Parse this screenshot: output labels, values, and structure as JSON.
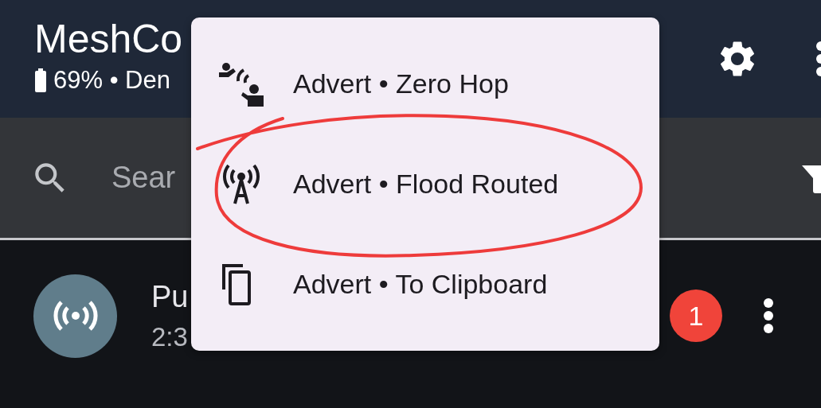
{
  "app_bar": {
    "title": "MeshCo",
    "subtitle": "69% • Den"
  },
  "search": {
    "placeholder": "Sear"
  },
  "contacts": [
    {
      "name": "Pu",
      "time": "2:3",
      "unread": "1"
    }
  ],
  "menu": {
    "items": [
      {
        "label": "Advert • Zero Hop",
        "kind": "zero-hop",
        "circled": false
      },
      {
        "label": "Advert • Flood Routed",
        "kind": "flood",
        "circled": true
      },
      {
        "label": "Advert • To Clipboard",
        "kind": "clipboard",
        "circled": false
      }
    ]
  }
}
